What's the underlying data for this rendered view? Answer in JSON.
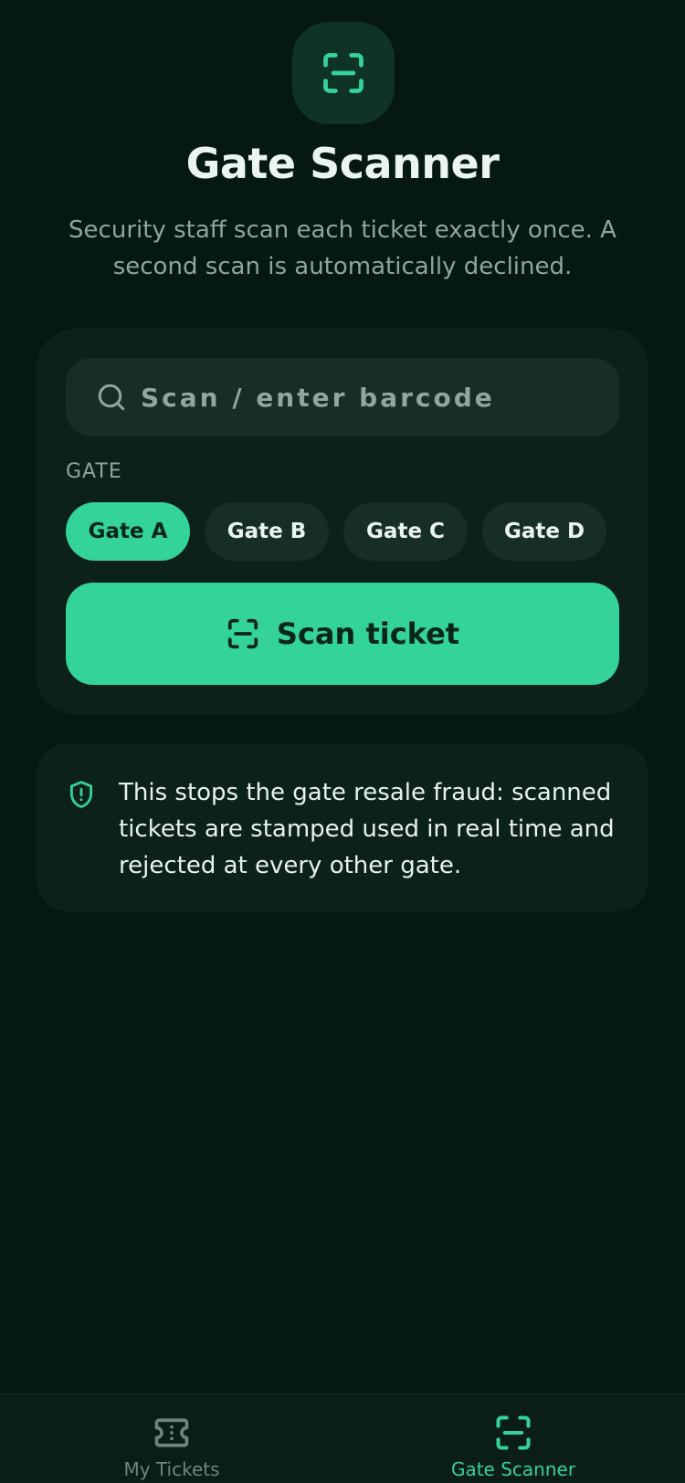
{
  "header": {
    "title": "Gate Scanner",
    "subtitle": "Security staff scan each ticket exactly once. A second scan is automatically declined.",
    "icon": "scan-icon"
  },
  "scan_card": {
    "search": {
      "value": "",
      "placeholder": "Scan / enter barcode",
      "icon": "search-icon"
    },
    "gate_label": "GATE",
    "gates": [
      "Gate A",
      "Gate B",
      "Gate C",
      "Gate D"
    ],
    "selected_gate": "Gate A",
    "scan_button_label": "Scan ticket"
  },
  "info": {
    "icon": "shield-alert-icon",
    "text": "This stops the gate resale fraud: scanned tickets are stamped used in real time and rejected at every other gate."
  },
  "bottom_nav": {
    "items": [
      {
        "label": "My Tickets",
        "icon": "ticket-icon",
        "active": false
      },
      {
        "label": "Gate Scanner",
        "icon": "scan-icon",
        "active": true
      }
    ]
  },
  "colors": {
    "background": "#061812",
    "card": "#0c2119",
    "accent": "#34d399",
    "muted_text": "#8fa69c"
  }
}
